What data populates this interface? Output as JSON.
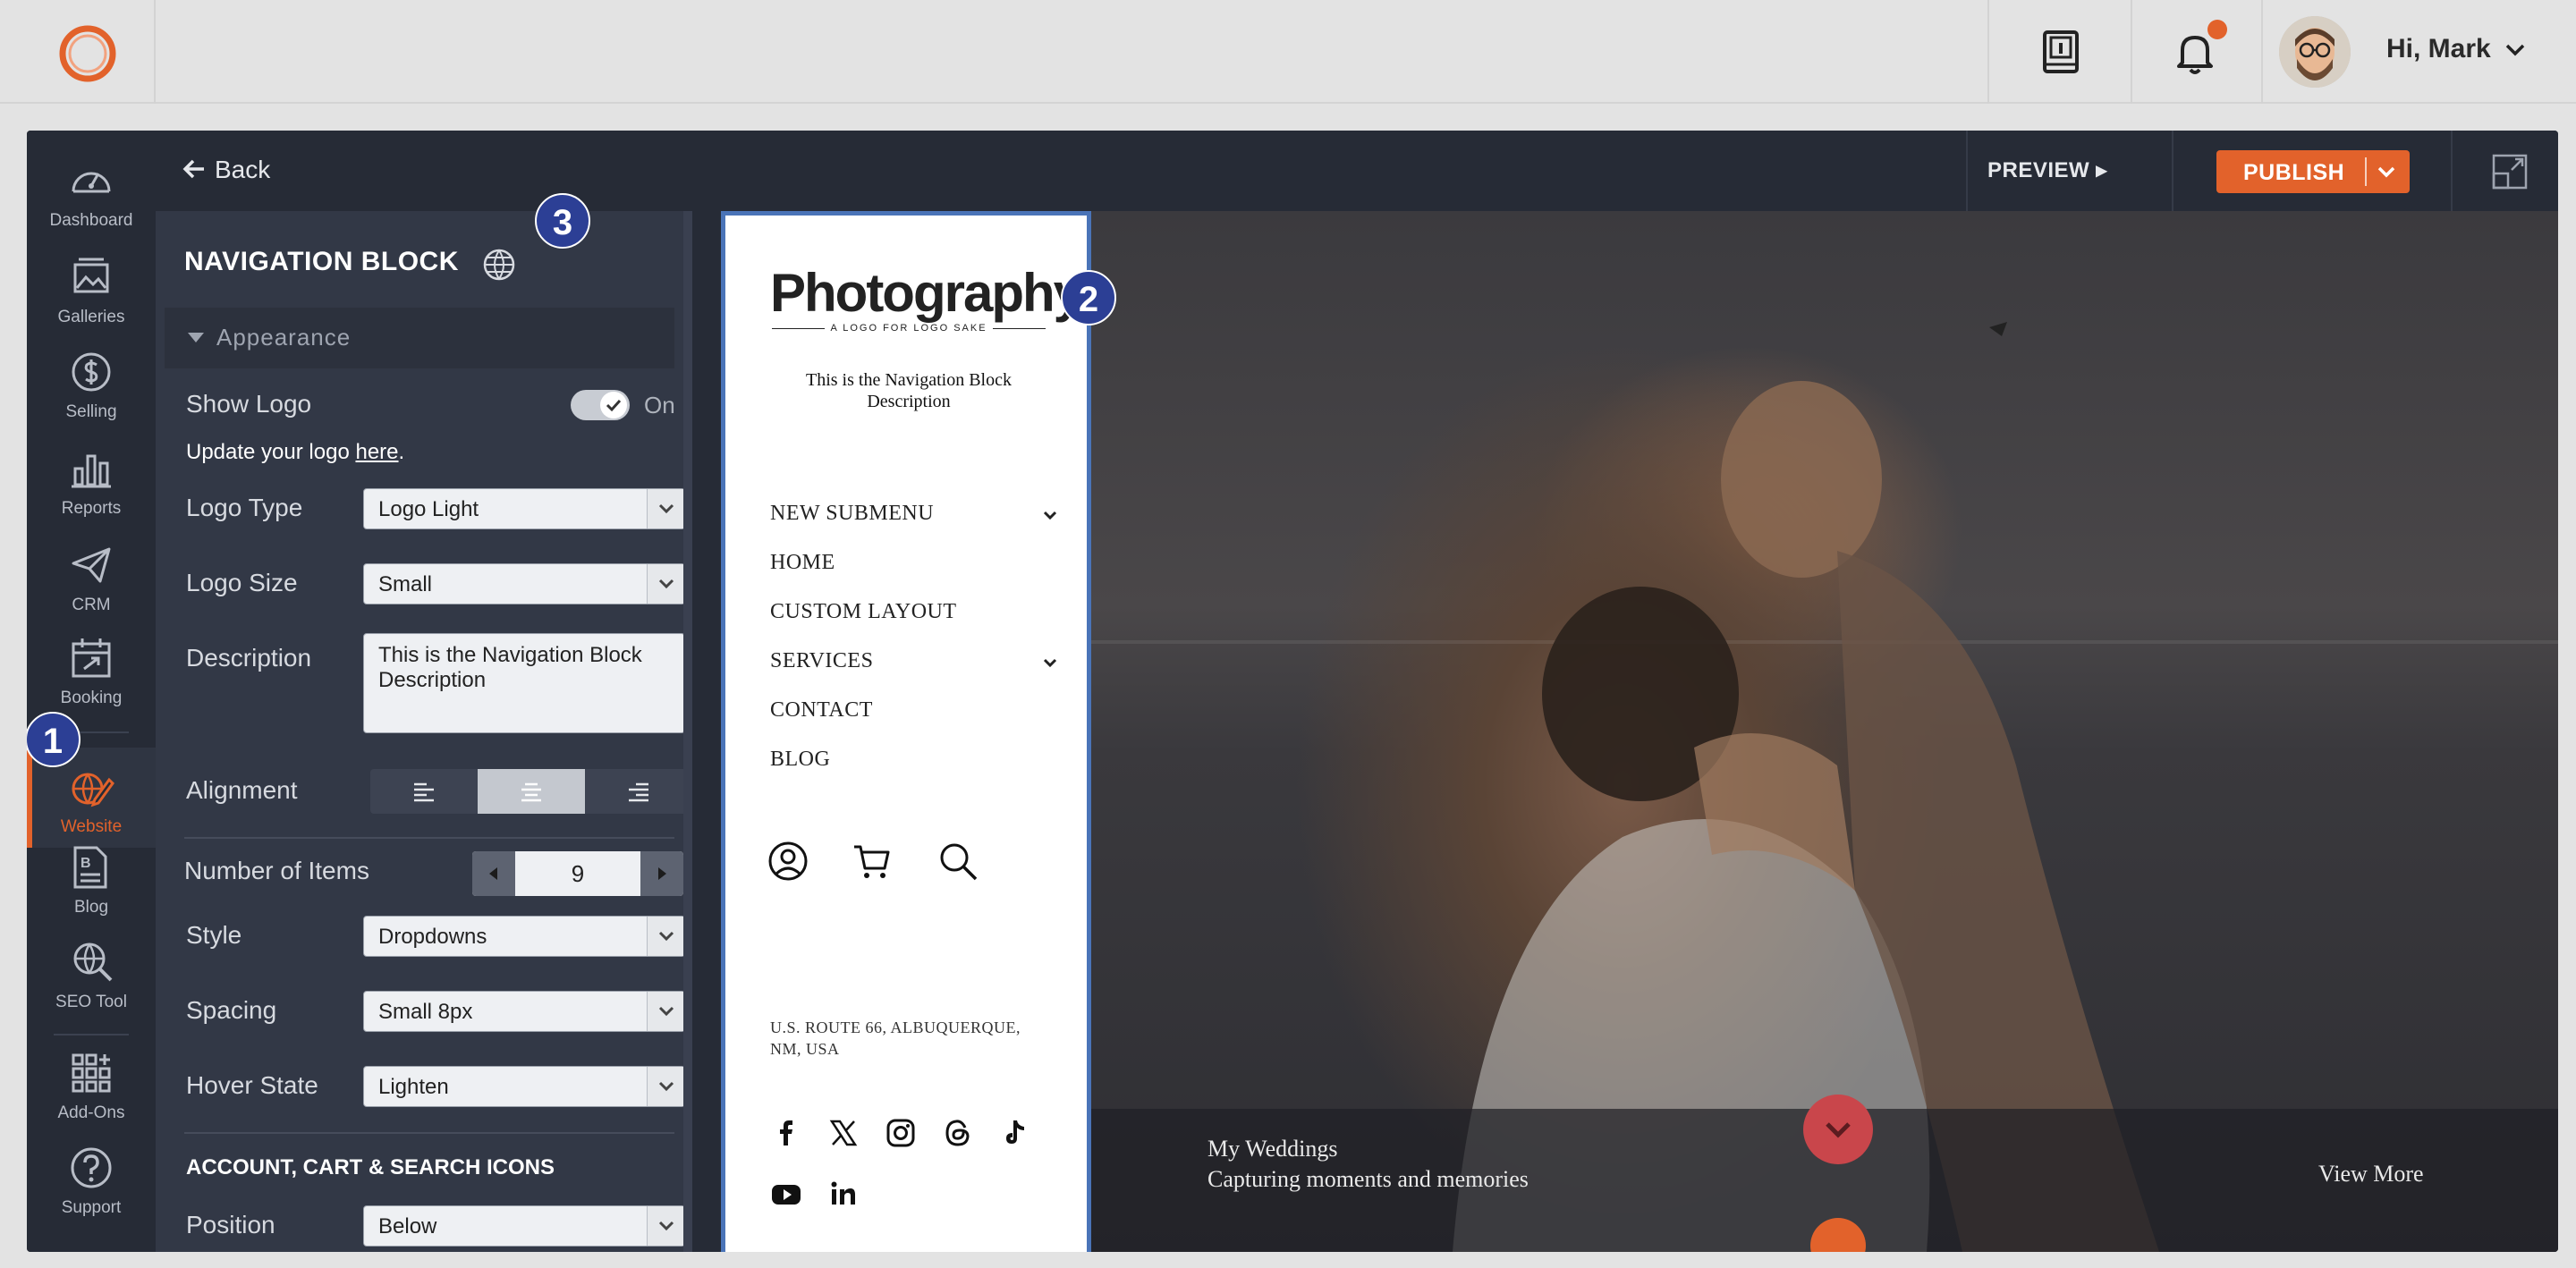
{
  "topbar": {
    "greeting": "Hi, Mark"
  },
  "leftnav": {
    "items": [
      {
        "label": "Dashboard",
        "icon": "gauge-icon"
      },
      {
        "label": "Galleries",
        "icon": "image-icon"
      },
      {
        "label": "Selling",
        "icon": "dollar-icon"
      },
      {
        "label": "Reports",
        "icon": "bar-chart-icon"
      },
      {
        "label": "CRM",
        "icon": "paper-plane-icon"
      },
      {
        "label": "Booking",
        "icon": "calendar-icon"
      },
      {
        "label": "Website",
        "icon": "website-edit-icon",
        "active": true
      },
      {
        "label": "Blog",
        "icon": "blog-icon"
      },
      {
        "label": "SEO Tool",
        "icon": "seo-globe-icon"
      },
      {
        "label": "Add-Ons",
        "icon": "grid-icon"
      },
      {
        "label": "Support",
        "icon": "help-icon"
      }
    ]
  },
  "steps": [
    "1",
    "2",
    "3"
  ],
  "panel": {
    "back_label": "Back",
    "title": "NAVIGATION BLOCK",
    "section_appearance": "Appearance",
    "show_logo_label": "Show Logo",
    "show_logo_state": "On",
    "update_logo_prefix": "Update your logo ",
    "update_logo_link": "here",
    "update_logo_suffix": ".",
    "logo_type_label": "Logo Type",
    "logo_type_value": "Logo Light",
    "logo_size_label": "Logo Size",
    "logo_size_value": "Small",
    "description_label": "Description",
    "description_value": "This is the Navigation Block Description",
    "alignment_label": "Alignment",
    "alignment_selected": "center",
    "number_items_label": "Number of Items",
    "number_items_value": "9",
    "style_label": "Style",
    "style_value": "Dropdowns",
    "spacing_label": "Spacing",
    "spacing_value": "Small 8px",
    "hover_label": "Hover State",
    "hover_value": "Lighten",
    "icons_section_title": "ACCOUNT, CART & SEARCH ICONS",
    "position_label": "Position",
    "position_value": "Below"
  },
  "preview_header": {
    "preview_label": "PREVIEW ▸",
    "publish_label": "PUBLISH"
  },
  "navblock": {
    "logo_text": "Photography",
    "logo_tagline": "A LOGO FOR LOGO SAKE",
    "description": "This is the Navigation Block Description",
    "links": [
      {
        "label": "NEW SUBMENU",
        "has_submenu": true
      },
      {
        "label": "HOME",
        "has_submenu": false
      },
      {
        "label": "CUSTOM LAYOUT",
        "has_submenu": false
      },
      {
        "label": "SERVICES",
        "has_submenu": true
      },
      {
        "label": "CONTACT",
        "has_submenu": false
      },
      {
        "label": "BLOG",
        "has_submenu": false
      }
    ],
    "address": "U.S. ROUTE 66, ALBUQUERQUE, NM, USA"
  },
  "hero": {
    "title": "My Weddings",
    "subtitle": "Capturing moments and memories",
    "view_more": "View More"
  },
  "colors": {
    "accent": "#e2622b",
    "dark_bg": "#262b36",
    "panel_bg": "#323846",
    "step_badge": "#2c3f95",
    "selection_border": "#4a74b8"
  }
}
